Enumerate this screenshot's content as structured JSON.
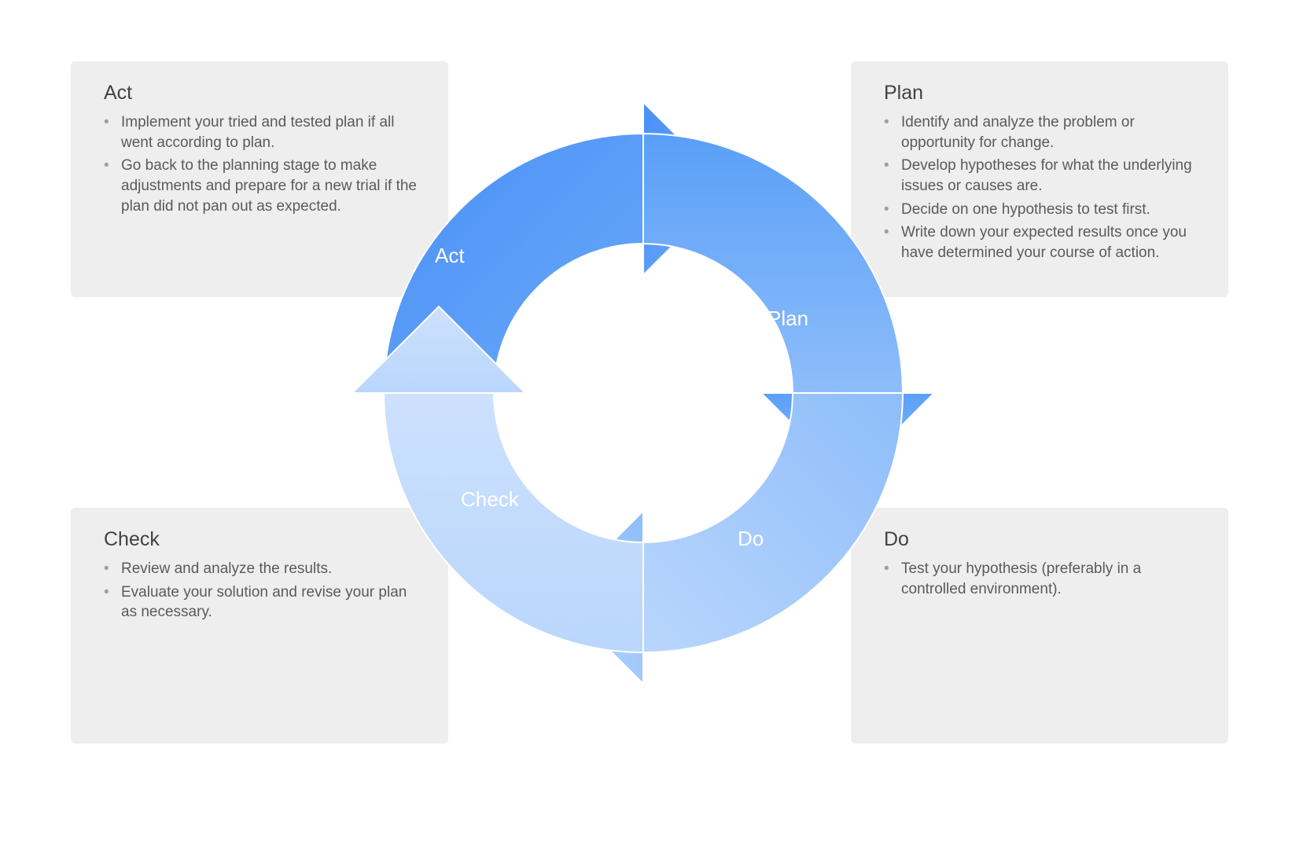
{
  "segments": {
    "plan": {
      "label": "Plan",
      "color_start": "#5a9ff8",
      "color_end": "#8ebdfa"
    },
    "do": {
      "label": "Do",
      "color_start": "#8ebdfa",
      "color_end": "#b9d6fc"
    },
    "check": {
      "label": "Check",
      "color_start": "#b9d6fc",
      "color_end": "#d6e7fd"
    },
    "act": {
      "label": "Act",
      "color_start": "#4a90f6",
      "color_end": "#5a9ff8"
    }
  },
  "panels": {
    "act": {
      "title": "Act",
      "items": [
        "Implement your tried and tested plan if all went according to plan.",
        "Go back to the planning stage to make adjustments and prepare for a new trial if the plan did not pan out as expected."
      ]
    },
    "plan": {
      "title": "Plan",
      "items": [
        "Identify and analyze the problem or opportunity for change.",
        "Develop hypotheses for what the underlying issues or causes are.",
        "Decide on one hypothesis to test first.",
        "Write down your expected results once you have determined your course of action."
      ]
    },
    "check": {
      "title": "Check",
      "items": [
        "Review and analyze the results.",
        "Evaluate your solution and revise your plan as necessary."
      ]
    },
    "do": {
      "title": "Do",
      "items": [
        "Test your hypothesis (preferably in a controlled environment)."
      ]
    }
  }
}
